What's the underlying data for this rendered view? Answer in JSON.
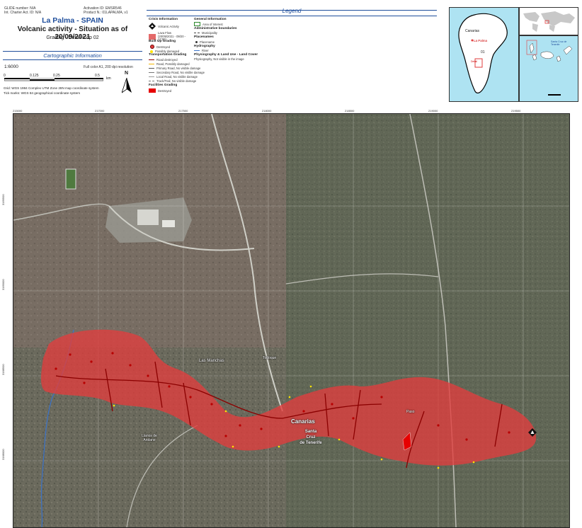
{
  "header": {
    "glide_number": "GLIDE number: N/A",
    "int_charter": "Int. Charter Act. ID: N/A",
    "activation_id": "Activation ID: EMSR546",
    "product_n": "Product N.: 01LAPALMA, v1",
    "title": "La Palma - SPAIN",
    "subtitle": "Volcanic activity - Situation as of 20/09/2021",
    "detail": "Grading - Detail map 02"
  },
  "cartographic": {
    "heading": "Cartographic Information",
    "scale": "1:6000",
    "resolution": "Full color A1, 200 dpi resolution",
    "scale_ticks": [
      "0",
      "0.125",
      "0.25",
      "0.5"
    ],
    "scale_unit": "km",
    "north_label": "N",
    "grid_note": "Grid: WGS 1984 Complex UTM Zone 28N map coordinate system",
    "tick_note": "Tick marks: WGS 84 geographical coordinate system"
  },
  "legend": {
    "heading": "Legend",
    "crisis_info": "Crisis Information",
    "volcanic_activity": "Volcanic Activity",
    "lava_flow": "Lava Flow (20/09/2021 - 09/20 - 17:00)",
    "built_up": "Built Up Grading",
    "destroyed": "Destroyed",
    "possibly_damaged": "Possibly damaged",
    "transport": "Transportation Grading",
    "road_destroyed": "Road destroyed",
    "road_possibly": "Road, Possibly damaged",
    "primary_road": "Primary Road, No visible damage",
    "secondary_road": "Secondary Road, No visible damage",
    "local_road": "Local Road, No visible damage",
    "track": "Track/Trail, No visible damage",
    "facilities": "Facilities Grading",
    "facility_destroyed": "Destroyed",
    "general_info": "General Information",
    "area_of_interest": "Area of Interest",
    "admin_boundaries": "Administrative boundaries",
    "municipality": "Municipality",
    "placenames": "Placenames",
    "placename_item": "Placename",
    "hydrography": "Hydrography",
    "river": "River",
    "physiography": "Physiography & Land Use - Land Cover",
    "physio_item": "Physiography, Not visible in the image"
  },
  "inset": {
    "canarias": "Canarias",
    "la_palma": "La Palma",
    "sheet": "01",
    "area": "Detail",
    "tenerife": "Santa Cruz de Tenerife"
  },
  "map": {
    "places": {
      "las_manchas": "Las Manchas",
      "todoque": "Todoque",
      "canarias": "Canarias",
      "santa_cruz_line1": "Santa",
      "santa_cruz_line2": "Cruz",
      "santa_cruz_line3": "de Tenerife",
      "paso": "Paso",
      "llanos": "Llanos de Aridane"
    },
    "x_ticks": [
      "215000",
      "217000",
      "217500",
      "218000",
      "218500",
      "219000",
      "219500"
    ],
    "y_ticks": [
      "3169500",
      "3169000",
      "3168500",
      "3168000"
    ]
  },
  "colors": {
    "accent": "#1f4e9c",
    "lava": "#e23d3d",
    "road_destroyed": "#8b0000",
    "possibly_damaged": "#ffe400"
  }
}
